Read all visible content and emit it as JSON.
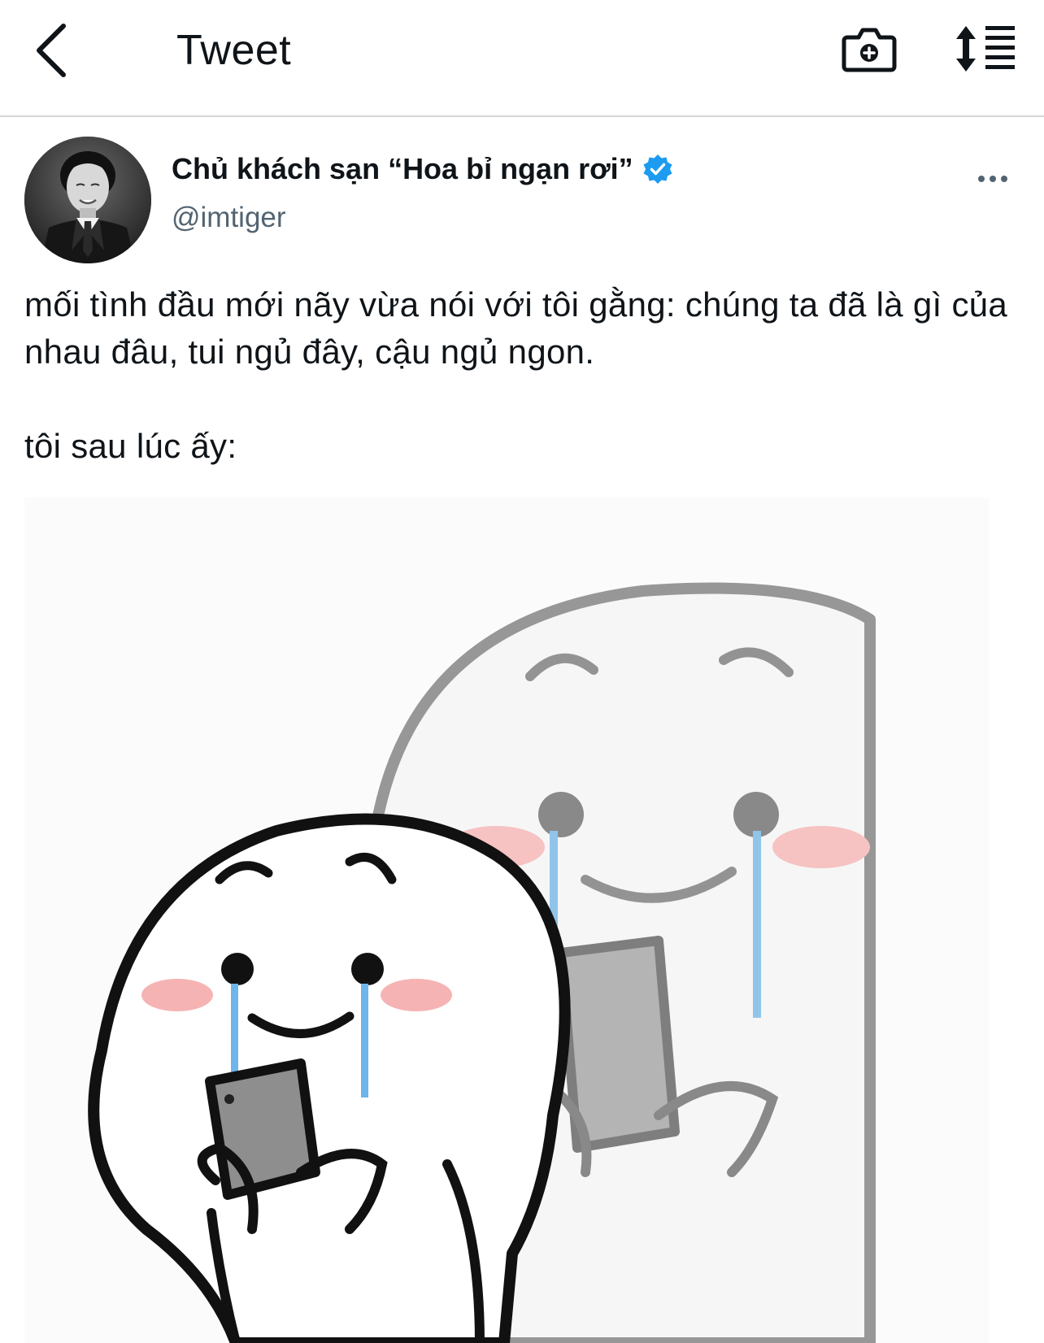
{
  "header": {
    "title": "Tweet",
    "back_icon": "chevron-left-icon",
    "camera_icon": "camera-plus-icon",
    "sort_icon": "sort-list-icon"
  },
  "tweet": {
    "display_name": "Chủ khách sạn “Hoa bỉ ngạn rơi”",
    "verified": true,
    "verified_color": "#1d9bf0",
    "handle": "@imtiger",
    "text": "mối tình đầu mới nãy vừa nói với tôi gằng: chúng ta đã là gì của nhau đâu, tui ngủ đây, cậu ngủ ngon.\n\ntôi sau lúc ấy:",
    "more_icon": "more-horizontal-icon",
    "media": {
      "type": "image",
      "icon": "crying-meme-icon"
    }
  },
  "colors": {
    "text_primary": "#0f1419",
    "text_secondary": "#536471",
    "divider": "#d6d6d6",
    "accent": "#1d9bf0"
  }
}
